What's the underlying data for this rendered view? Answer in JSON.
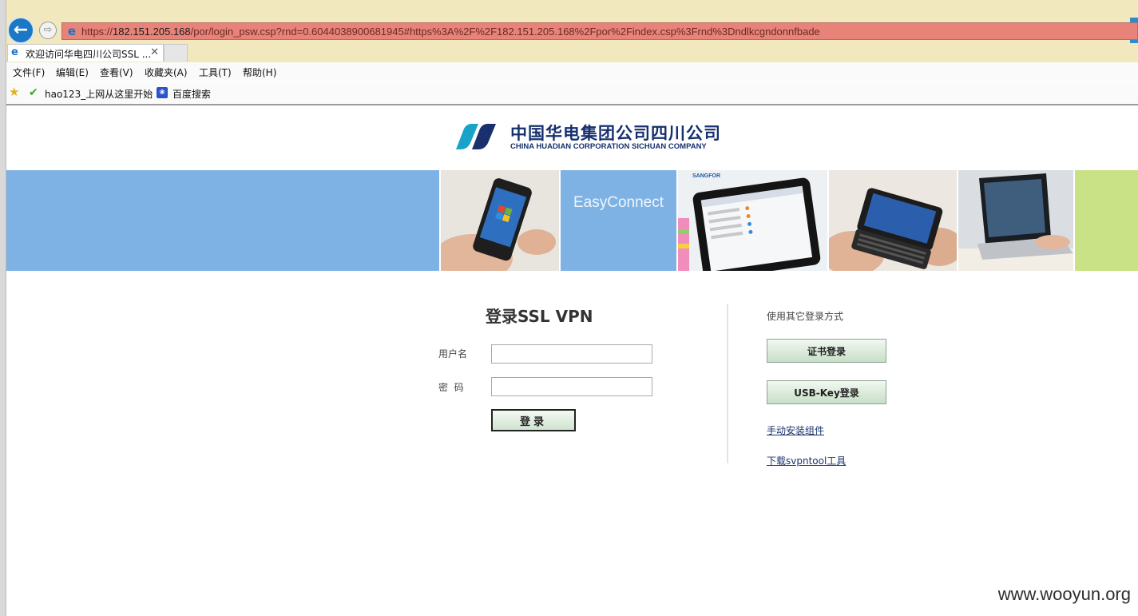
{
  "browser": {
    "url_prefix": "https://",
    "url_host": "182.151.205.168",
    "url_path": "/por/login_psw.csp?rnd=0.6044038900681945#https%3A%2F%2F182.151.205.168%2Fpor%2Findex.csp%3Frnd%3Dndlkcgndonnfbade",
    "tab_title": "欢迎访问华电四川公司SSL ...",
    "menu": [
      "文件(F)",
      "编辑(E)",
      "查看(V)",
      "收藏夹(A)",
      "工具(T)",
      "帮助(H)"
    ],
    "favorites": [
      "hao123_上网从这里开始",
      "百度搜索"
    ],
    "icons": [
      "back-icon",
      "forward-icon",
      "ie-icon",
      "close-icon",
      "star-icon",
      "hao123-icon",
      "baidu-icon"
    ]
  },
  "header": {
    "company_cn": "中国华电集团公司四川公司",
    "company_en": "CHINA HUADIAN CORPORATION SICHUAN COMPANY"
  },
  "banner": {
    "easyconnect": "EasyConnect",
    "sangfor": "SANGFOR",
    "colors": {
      "blue": "#7fb2e4",
      "green": "#c9e285"
    }
  },
  "login": {
    "title": "登录SSL VPN",
    "username_label": "用户名",
    "password_label": "密  码",
    "username_value": "",
    "password_value": "",
    "submit_label": "登录"
  },
  "alt_login": {
    "title": "使用其它登录方式",
    "cert_button": "证书登录",
    "usbkey_button": "USB-Key登录",
    "install_link": "手动安装组件",
    "download_link": "下载svpntool工具"
  },
  "watermark": "www.wooyun.org"
}
